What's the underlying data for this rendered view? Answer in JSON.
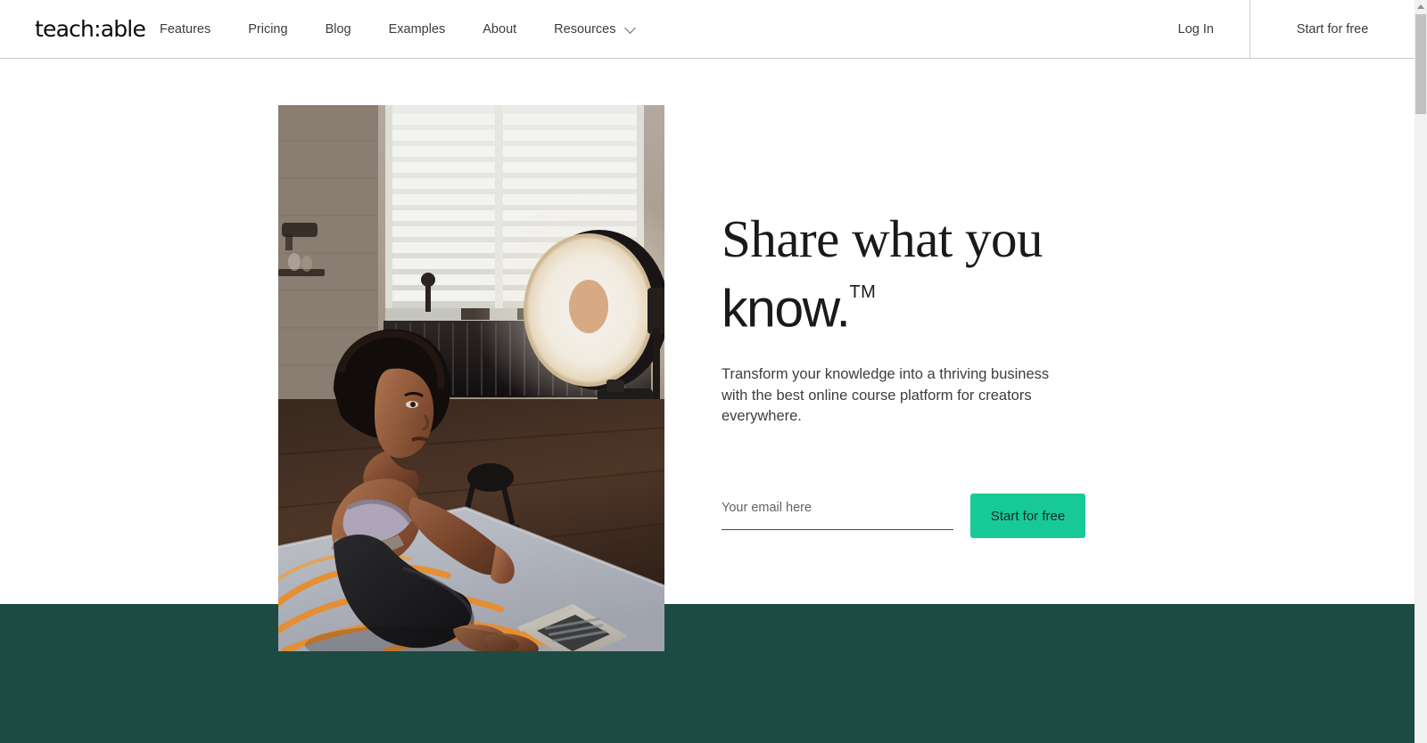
{
  "brand": {
    "name": "teach:able"
  },
  "nav": {
    "links": [
      {
        "label": "Features"
      },
      {
        "label": "Pricing"
      },
      {
        "label": "Blog"
      },
      {
        "label": "Examples"
      },
      {
        "label": "About"
      },
      {
        "label": "Resources",
        "has_dropdown": true,
        "icon": "chevron-down-icon"
      }
    ],
    "login_label": "Log In",
    "start_free_label": "Start for free"
  },
  "hero": {
    "headline_serif": "Share what you",
    "headline_sans": "know.",
    "headline_tm": "TM",
    "subcopy": "Transform your knowledge into a thriving business with the best online course platform for creators everywhere.",
    "image_alt": "Woman sitting on a patterned yoga mat in a studio with ring light, camera on tripod and open laptop"
  },
  "signup": {
    "email_placeholder": "Your email here",
    "email_value": "",
    "cta_label": "Start for free"
  },
  "colors": {
    "accent_green": "#18c998",
    "band_teal": "#1d4a43",
    "nav_text": "#3c3c3c",
    "headline": "#1a1a1a",
    "body_text": "#3a3f44",
    "cta_text": "#142a25",
    "scrollbar_thumb": "#c1c1c1"
  },
  "scrollbar": {
    "position": "top",
    "orientation": "vertical"
  }
}
